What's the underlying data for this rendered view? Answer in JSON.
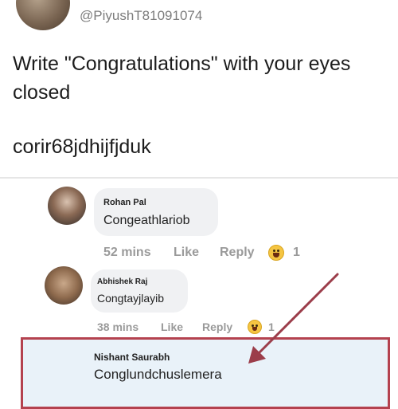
{
  "post": {
    "handle": "@PiyushT81091074",
    "text": "Write \"Congratulations\" with your eyes closed",
    "reply_text": "corir68jdhijfjduk"
  },
  "comments": [
    {
      "name": "Rohan Pal",
      "text": "Congeathlariob",
      "time": "52 mins",
      "like": "Like",
      "reply": "Reply",
      "reaction_count": "1"
    },
    {
      "name": "Abhishek Raj",
      "text": "Congtayjlayib",
      "time": "38 mins",
      "like": "Like",
      "reply": "Reply",
      "reaction_count": "1"
    },
    {
      "name": "Nishant Saurabh",
      "text": "Conglundchuslemera"
    }
  ],
  "colors": {
    "highlight_border": "#b4424f",
    "arrow": "#9b3d4a",
    "bubble": "#f0f1f3"
  },
  "icons": {
    "reaction": "laughing-emoji-icon"
  }
}
